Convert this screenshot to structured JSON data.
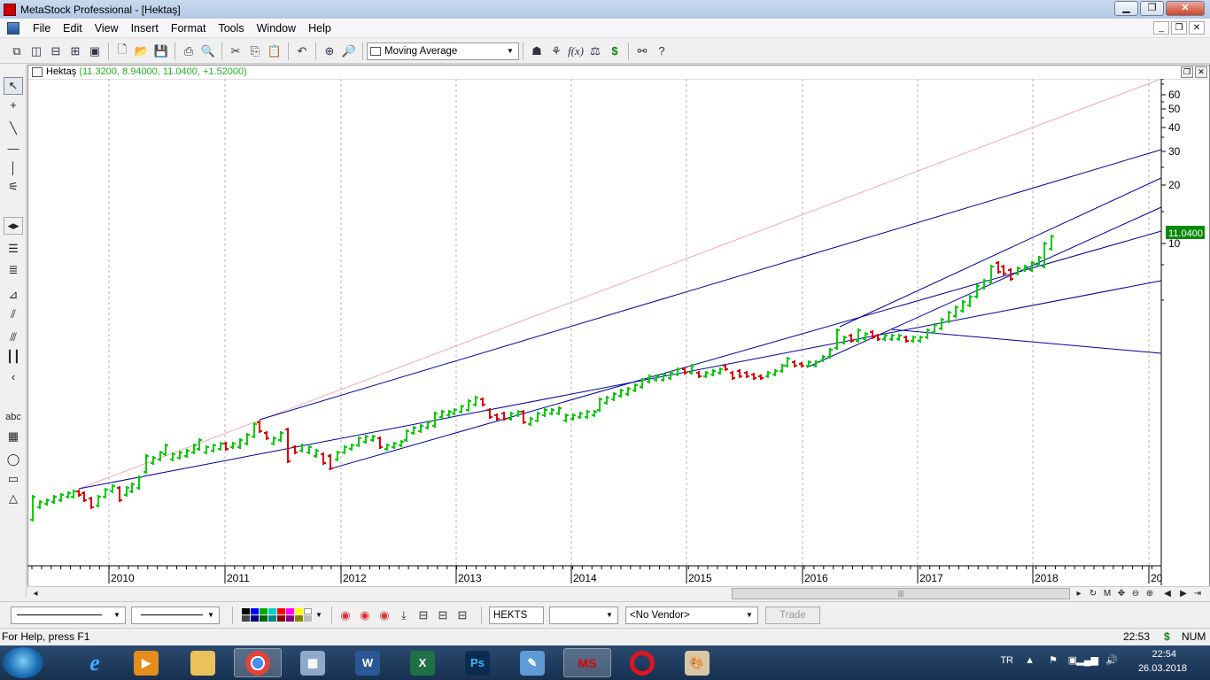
{
  "window": {
    "title": "MetaStock Professional - [Hektaş]"
  },
  "menu": [
    "File",
    "Edit",
    "View",
    "Insert",
    "Format",
    "Tools",
    "Window",
    "Help"
  ],
  "toolbar": {
    "indicator_combo": "Moving Average"
  },
  "chart_window": {
    "symbol": "Hektaş",
    "ohlc": "(11.3200, 8.94000, 11.0400, +1.52000)"
  },
  "left_tools": {
    "text_tool": "abc"
  },
  "bottom": {
    "symbol_box": "HEKTS",
    "vendor_combo": "<No Vendor>",
    "trade_button": "Trade"
  },
  "status": {
    "help": "For Help, press F1",
    "time": "22:53",
    "dollar": "$",
    "num": "NUM"
  },
  "taskbar": {
    "lang": "TR",
    "clock_time": "22:54",
    "clock_date": "26.03.2018"
  },
  "scrollbar": {
    "m_label": "M"
  },
  "chart_data": {
    "type": "bar",
    "x_tick_labels": [
      "2010",
      "2011",
      "2012",
      "2013",
      "2014",
      "2015",
      "2016",
      "2017",
      "2018",
      "20"
    ],
    "y_tick_labels": [
      60,
      50,
      40,
      30,
      20,
      10
    ],
    "y_scale": "log",
    "last_price_label": "11.0400",
    "up_color": "#00cc00",
    "down_color": "#e00000",
    "trendline_color": "#0000a0",
    "long_trendline_color": "#f4a6b4",
    "grid": "vertical dashed"
  }
}
